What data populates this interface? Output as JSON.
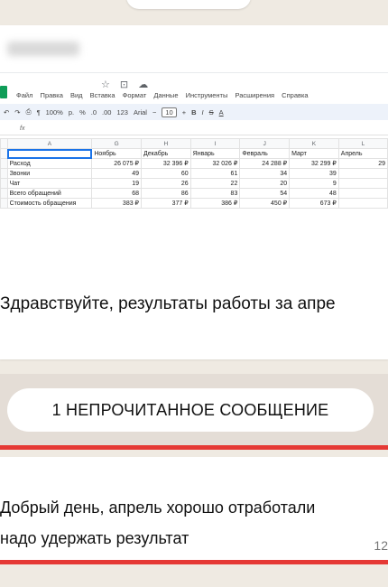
{
  "message1": {
    "text": "Здравствуйте, результаты работы за апре"
  },
  "sheet": {
    "menu": [
      "Файл",
      "Правка",
      "Вид",
      "Вставка",
      "Формат",
      "Данные",
      "Инструменты",
      "Расширения",
      "Справка"
    ],
    "toolbar": {
      "zoom": "100%",
      "currency": "р.",
      "percent": "%",
      "dec_less": ".0",
      "dec_more": ".00",
      "num_format": "123",
      "font": "Arial",
      "font_size": "10",
      "minus": "−",
      "plus": "+",
      "bold": "B",
      "italic": "I",
      "strike": "S",
      "text_color": "A"
    },
    "formula_fx": "fx",
    "col_headers": [
      "A",
      "G",
      "H",
      "I",
      "J",
      "K",
      "L"
    ],
    "months": [
      "Ноябрь",
      "Декабрь",
      "Январь",
      "Февраль",
      "Март",
      "Апрель"
    ],
    "rows": [
      {
        "label": "Расход",
        "values": [
          "26 075 ₽",
          "32 396 ₽",
          "32 026 ₽",
          "24 288 ₽",
          "32 299 ₽",
          "29"
        ]
      },
      {
        "label": "Звонки",
        "values": [
          "49",
          "60",
          "61",
          "34",
          "39",
          ""
        ]
      },
      {
        "label": "Чат",
        "values": [
          "19",
          "26",
          "22",
          "20",
          "9",
          ""
        ]
      },
      {
        "label": "Всего обращений",
        "values": [
          "68",
          "86",
          "83",
          "54",
          "48",
          ""
        ]
      },
      {
        "label": "Стоимость обращения",
        "values": [
          "383 ₽",
          "377 ₽",
          "386 ₽",
          "450 ₽",
          "673 ₽",
          ""
        ]
      }
    ]
  },
  "unread": {
    "label": "1 НЕПРОЧИТАННОЕ СООБЩЕНИЕ"
  },
  "message2": {
    "line1": "Добрый день, апрель хорошо отработали",
    "line2": "надо удержать результат",
    "time": "12"
  },
  "colors": {
    "highlight_red": "#e53935",
    "chat_bg": "#efeae2",
    "selection_blue": "#1a73e8"
  }
}
